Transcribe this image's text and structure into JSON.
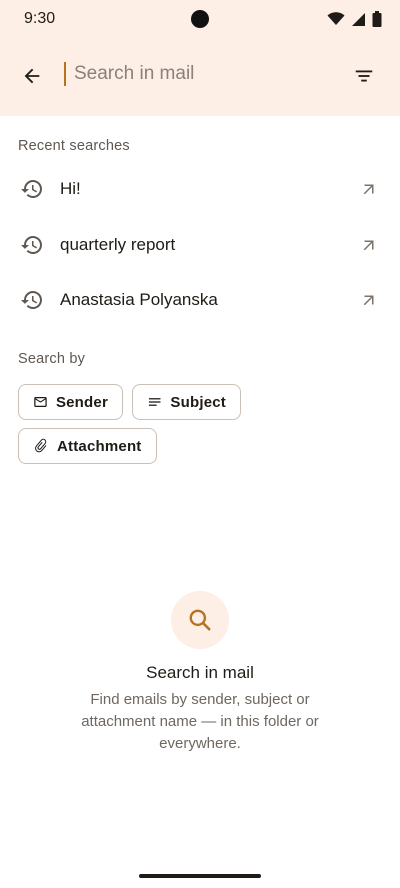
{
  "status": {
    "time": "9:30"
  },
  "header": {
    "search_placeholder": "Search in mail",
    "search_value": ""
  },
  "recent": {
    "label": "Recent searches",
    "items": [
      {
        "text": "Hi!"
      },
      {
        "text": "quarterly report"
      },
      {
        "text": "Anastasia Polyanska"
      }
    ]
  },
  "search_by": {
    "label": "Search by",
    "chips": [
      {
        "label": "Sender",
        "icon": "mail-icon"
      },
      {
        "label": "Subject",
        "icon": "subject-lines-icon"
      },
      {
        "label": "Attachment",
        "icon": "paperclip-icon"
      }
    ]
  },
  "empty_state": {
    "icon": "search-icon",
    "title": "Search in mail",
    "description": "Find emails by sender, subject or attachment name — in this folder or everywhere."
  },
  "colors": {
    "header_bg": "#fdeee6",
    "accent": "#b5731e",
    "text_primary": "#1f1b16",
    "text_secondary": "#6f6760"
  }
}
